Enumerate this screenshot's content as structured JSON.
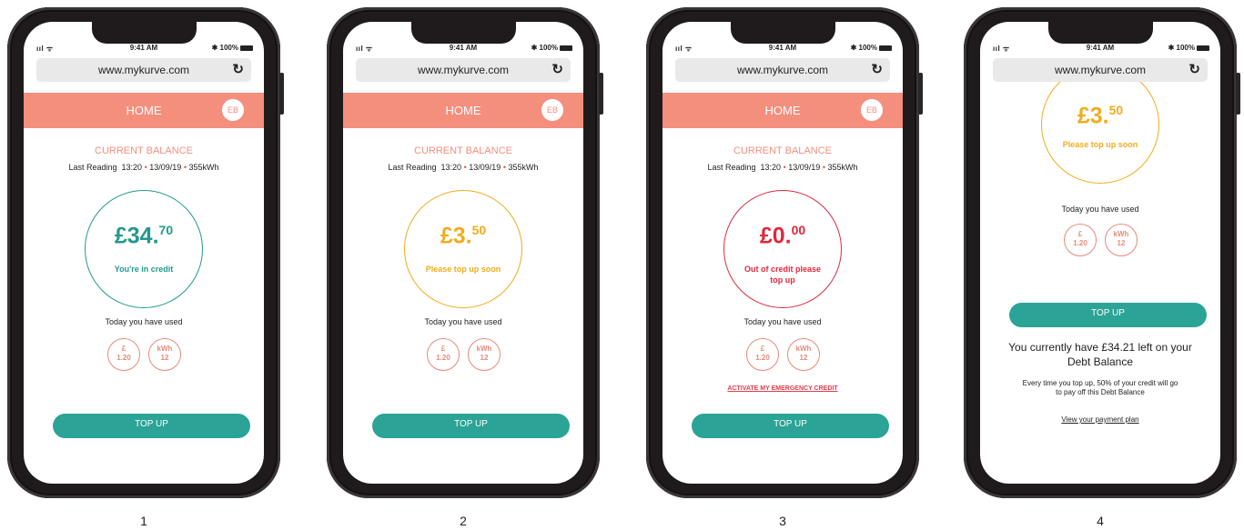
{
  "browser": {
    "url": "www.mykurve.com",
    "time": "9:41 AM",
    "signal": "ııl ᯤ",
    "battery": "✱ 100%"
  },
  "header": {
    "title": "HOME",
    "avatar": "EB"
  },
  "balance_title": "CURRENT BALANCE",
  "reading": {
    "label": "Last Reading",
    "time": "13:20",
    "date": "13/09/19",
    "usage": "355kWh",
    "sep": "•"
  },
  "used_label": "Today you have used",
  "usage_today": {
    "cost_symbol": "£",
    "cost": "1.20",
    "unit": "kWh",
    "kwh": "12"
  },
  "topup_label": "TOP UP",
  "screens": [
    {
      "caption": "1",
      "amount_main": "£34.",
      "amount_pence": "70",
      "message": "You're in credit",
      "color": "#22998c"
    },
    {
      "caption": "2",
      "amount_main": "£3.",
      "amount_pence": "50",
      "message": "Please top up soon",
      "color": "#f0ac1c"
    },
    {
      "caption": "3",
      "amount_main": "£0.",
      "amount_pence": "00",
      "message": "Out of credit please top up",
      "color": "#e0283c",
      "emergency_link": "ACTIVATE MY EMERGENCY CREDIT"
    },
    {
      "caption": "4",
      "amount_main": "£3.",
      "amount_pence": "50",
      "message": "Please top up soon",
      "color": "#f0ac1c",
      "debt_balance": "You currently have £34.21 left on your Debt Balance",
      "debt_info": "Every time you top up, 50% of your credit will go to pay off this Debt Balance",
      "plan_link": "View your payment plan"
    }
  ]
}
